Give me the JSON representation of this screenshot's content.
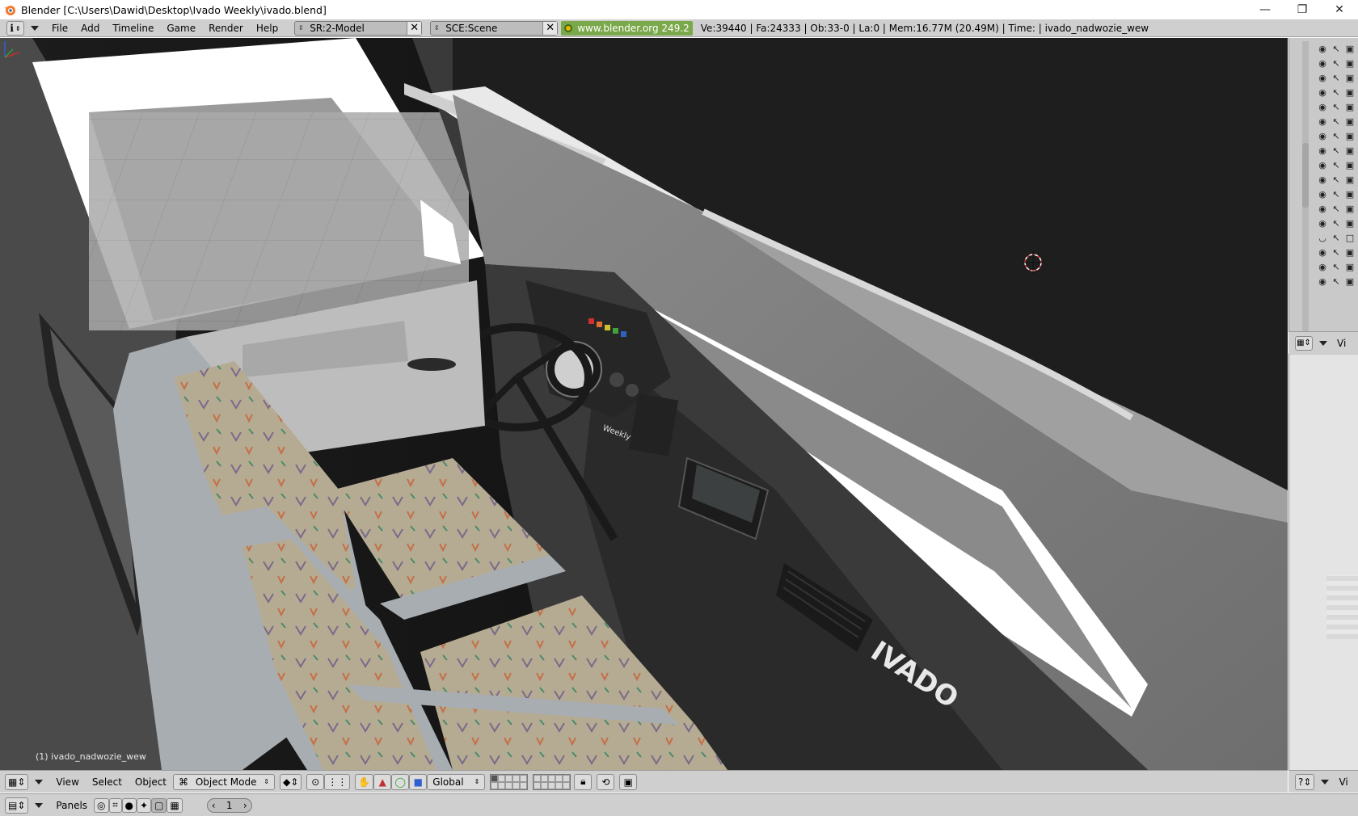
{
  "window": {
    "title": "Blender [C:\\Users\\Dawid\\Desktop\\Ivado Weekly\\ivado.blend]",
    "minimize": "—",
    "maximize": "❐",
    "close": "✕"
  },
  "info_header": {
    "menus": [
      "File",
      "Add",
      "Timeline",
      "Game",
      "Render",
      "Help"
    ],
    "screen_field": "SR:2-Model",
    "scene_field": "SCE:Scene",
    "website": "www.blender.org 249.2",
    "stats": "Ve:39440 | Fa:24333 | Ob:33-0 | La:0  | Mem:16.77M (20.49M)  | Time: | ivado_nadwozie_wew"
  },
  "viewport": {
    "object_label": "(1) ivado_nadwozie_wew",
    "dashboard_brand": "IVADO",
    "gauge_brand": "Weekly"
  },
  "outliner": {
    "header_label": "Vi",
    "rows": [
      {
        "visible": true
      },
      {
        "visible": true
      },
      {
        "visible": true
      },
      {
        "visible": true
      },
      {
        "visible": true
      },
      {
        "visible": true
      },
      {
        "visible": true
      },
      {
        "visible": true
      },
      {
        "visible": true
      },
      {
        "visible": true
      },
      {
        "visible": true
      },
      {
        "visible": true
      },
      {
        "visible": true
      },
      {
        "visible": false
      },
      {
        "visible": true
      },
      {
        "visible": true
      },
      {
        "visible": true
      }
    ]
  },
  "view3d_header": {
    "menus": [
      "View",
      "Select",
      "Object"
    ],
    "mode": "Object Mode",
    "orientation": "Global",
    "right_label": "Vi"
  },
  "buttons_header": {
    "panels_label": "Panels",
    "frame": "1"
  }
}
